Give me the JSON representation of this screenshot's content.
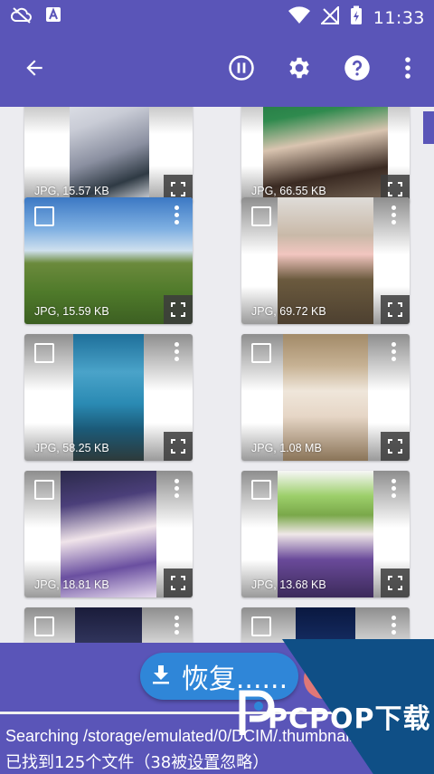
{
  "status_bar": {
    "time": "11:33",
    "icons": [
      "cloud-off-icon",
      "font-a-icon",
      "wifi-icon",
      "signal-off-icon",
      "battery-charging-icon"
    ]
  },
  "app_bar": {
    "icons": [
      "arrow-back-icon",
      "pause-circle-icon",
      "settings-icon",
      "help-icon",
      "more-vert-icon"
    ]
  },
  "items": [
    {
      "caption": "JPG, 15.57 KB"
    },
    {
      "caption": "JPG, 66.55 KB"
    },
    {
      "caption": "JPG, 15.59 KB"
    },
    {
      "caption": "JPG, 69.72 KB"
    },
    {
      "caption": "JPG, 58.25 KB"
    },
    {
      "caption": "JPG, 1.08 MB"
    },
    {
      "caption": "JPG, 18.81 KB"
    },
    {
      "caption": "JPG, 13.68 KB"
    },
    {
      "caption": ""
    },
    {
      "caption": ""
    }
  ],
  "restore_button": {
    "label": "恢复......",
    "icon": "download-icon"
  },
  "status": {
    "scanning": "Searching /storage/emulated/0/DCIM/.thumbnails",
    "found_prefix": "已找到125个文件（38被",
    "found_link": "设置",
    "found_suffix": "忽略）"
  },
  "watermark": {
    "text": "PCPOP下载"
  },
  "colors": {
    "primary": "#5a55b8",
    "accent": "#2f86d8"
  }
}
